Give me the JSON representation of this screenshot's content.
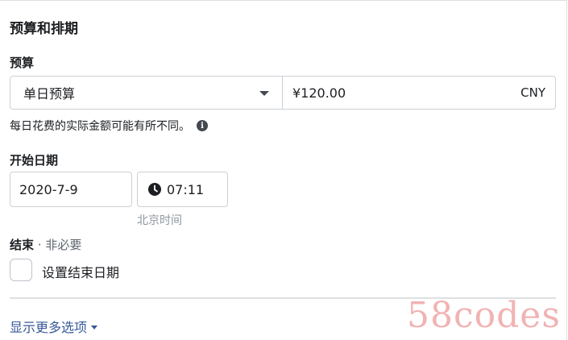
{
  "section": {
    "title": "预算和排期"
  },
  "budget": {
    "label": "预算",
    "type_selected": "单日预算",
    "amount": "¥120.00",
    "currency": "CNY",
    "note": "每日花费的实际金额可能有所不同。"
  },
  "start": {
    "label": "开始日期",
    "date": "2020-7-9",
    "time": "07:11",
    "timezone": "北京时间"
  },
  "end": {
    "label": "结束",
    "optional": " · 非必要",
    "checkbox_label": "设置结束日期",
    "checked": false
  },
  "more": {
    "label": "显示更多选项"
  },
  "watermark": {
    "text": "58codes"
  },
  "colors": {
    "link": "#385898",
    "border": "#ccd0d5",
    "text": "#1c1e21",
    "muted": "#8d949e"
  }
}
